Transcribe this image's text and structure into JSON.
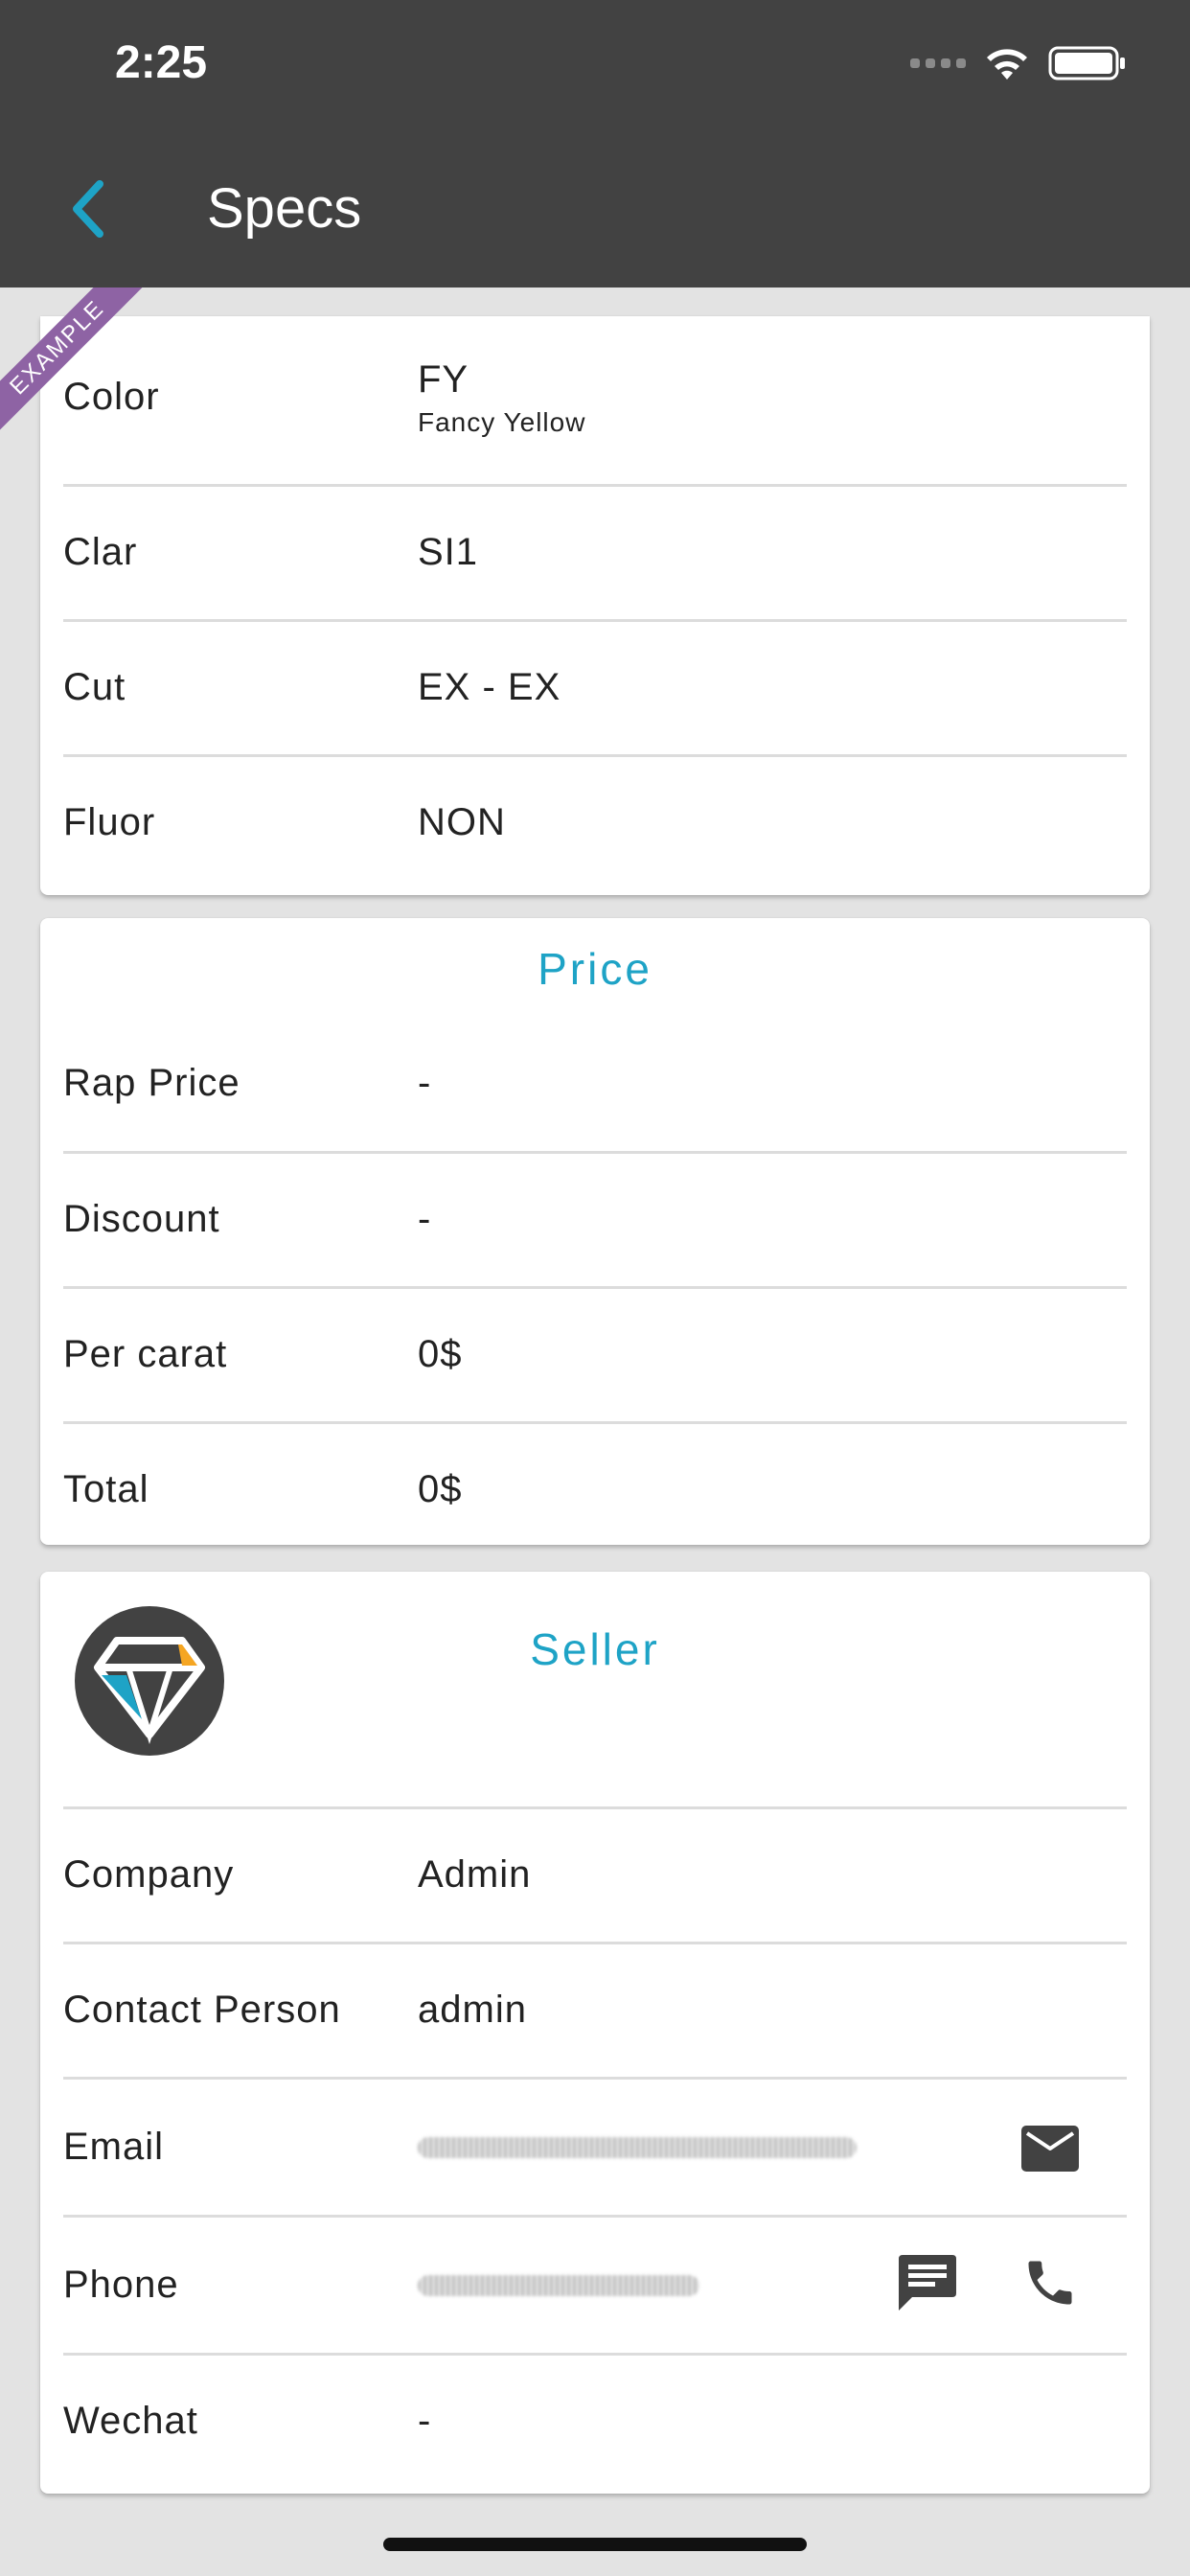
{
  "status_bar": {
    "time": "2:25"
  },
  "app_bar": {
    "title": "Specs"
  },
  "ribbon": {
    "text": "EXAMPLE"
  },
  "specs": {
    "color": {
      "label": "Color",
      "value": "FY",
      "sub": "Fancy Yellow"
    },
    "clarity": {
      "label": "Clar",
      "value": "SI1"
    },
    "cut": {
      "label": "Cut",
      "value": "EX - EX"
    },
    "fluor": {
      "label": "Fluor",
      "value": "NON"
    }
  },
  "price": {
    "title": "Price",
    "rows": [
      {
        "label": "Rap Price",
        "value": "-"
      },
      {
        "label": "Discount",
        "value": "-"
      },
      {
        "label": "Per carat",
        "value": "0$"
      },
      {
        "label": "Total",
        "value": "0$"
      }
    ]
  },
  "seller": {
    "title": "Seller",
    "company": {
      "label": "Company",
      "value": "Admin"
    },
    "contact": {
      "label": "Contact Person",
      "value": "admin"
    },
    "email": {
      "label": "Email"
    },
    "phone": {
      "label": "Phone"
    },
    "wechat": {
      "label": "Wechat",
      "value": "-"
    }
  },
  "icons": {
    "back": "chevron-left-icon",
    "email": "mail-icon",
    "sms": "message-icon",
    "call": "phone-icon",
    "logo": "diamond-logo"
  },
  "colors": {
    "app_bar": "#424242",
    "accent": "#1ea3c6",
    "ribbon": "#8e63a4",
    "background": "#e3e3e3"
  }
}
